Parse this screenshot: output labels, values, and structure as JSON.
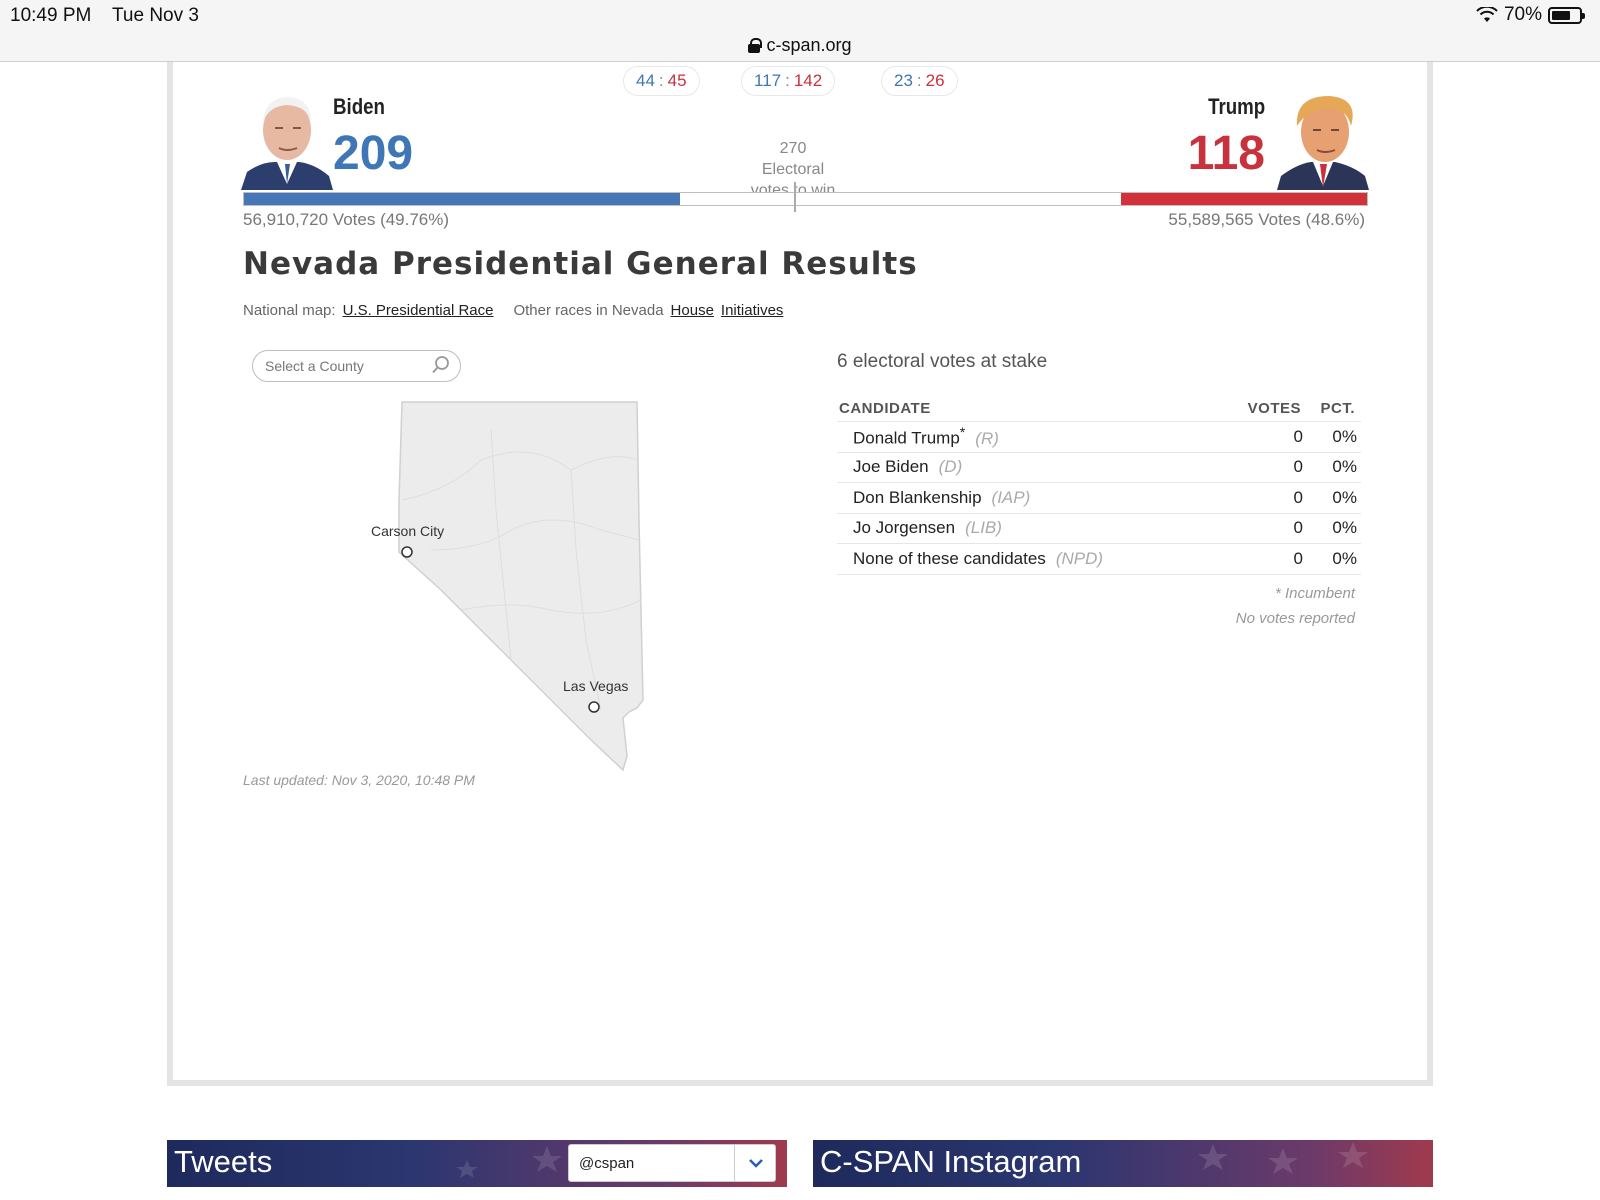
{
  "status_bar": {
    "time": "10:49 PM",
    "date": "Tue Nov 3",
    "battery": "70%",
    "battery_level": 0.7
  },
  "url_bar": {
    "domain": "c-span.org"
  },
  "tossups": [
    {
      "dem": "44",
      "sep": ":",
      "rep": "45"
    },
    {
      "dem": "117",
      "sep": ":",
      "rep": "142"
    },
    {
      "dem": "23",
      "sep": ":",
      "rep": "26"
    }
  ],
  "candidates": {
    "left": {
      "name": "Biden",
      "ev": "209",
      "popular": "56,910,720 Votes (49.76%)"
    },
    "right": {
      "name": "Trump",
      "ev": "118",
      "popular": "55,589,565 Votes (48.6%)"
    }
  },
  "threshold": {
    "line1": "270",
    "line2": "Electoral",
    "line3": "votes to win"
  },
  "ev_bar": {
    "total": 538,
    "dem": 209,
    "rep": 118,
    "dem_color": "#4676b8",
    "rep_color": "#d2313a"
  },
  "title": "Nevada Presidential General Results",
  "links": {
    "national_label": "National map:",
    "national_link": "U.S. Presidential Race",
    "other_label": "Other races in Nevada",
    "house": "House",
    "initiatives": "Initiatives"
  },
  "county_select": {
    "placeholder": "Select a County"
  },
  "map": {
    "cities": [
      "Carson City",
      "Las Vegas"
    ]
  },
  "last_updated": "Last updated: Nov 3, 2020, 10:48 PM",
  "stake": "6 electoral votes at stake",
  "table": {
    "headers": {
      "candidate": "CANDIDATE",
      "votes": "VOTES",
      "pct": "PCT."
    },
    "rows": [
      {
        "name": "Donald Trump",
        "mark": "*",
        "party": "(R)",
        "votes": "0",
        "pct": "0%"
      },
      {
        "name": "Joe Biden",
        "mark": "",
        "party": "(D)",
        "votes": "0",
        "pct": "0%"
      },
      {
        "name": "Don Blankenship",
        "mark": "",
        "party": "(IAP)",
        "votes": "0",
        "pct": "0%"
      },
      {
        "name": "Jo Jorgensen",
        "mark": "",
        "party": "(LIB)",
        "votes": "0",
        "pct": "0%"
      },
      {
        "name": "None of these candidates",
        "mark": "",
        "party": "(NPD)",
        "votes": "0",
        "pct": "0%"
      }
    ],
    "note_incumbent": "* Incumbent",
    "note_reported": "No votes reported"
  },
  "banners": {
    "tweets": {
      "title": "Tweets",
      "select_value": "@cspan"
    },
    "instagram": {
      "title": "C-SPAN Instagram"
    }
  }
}
